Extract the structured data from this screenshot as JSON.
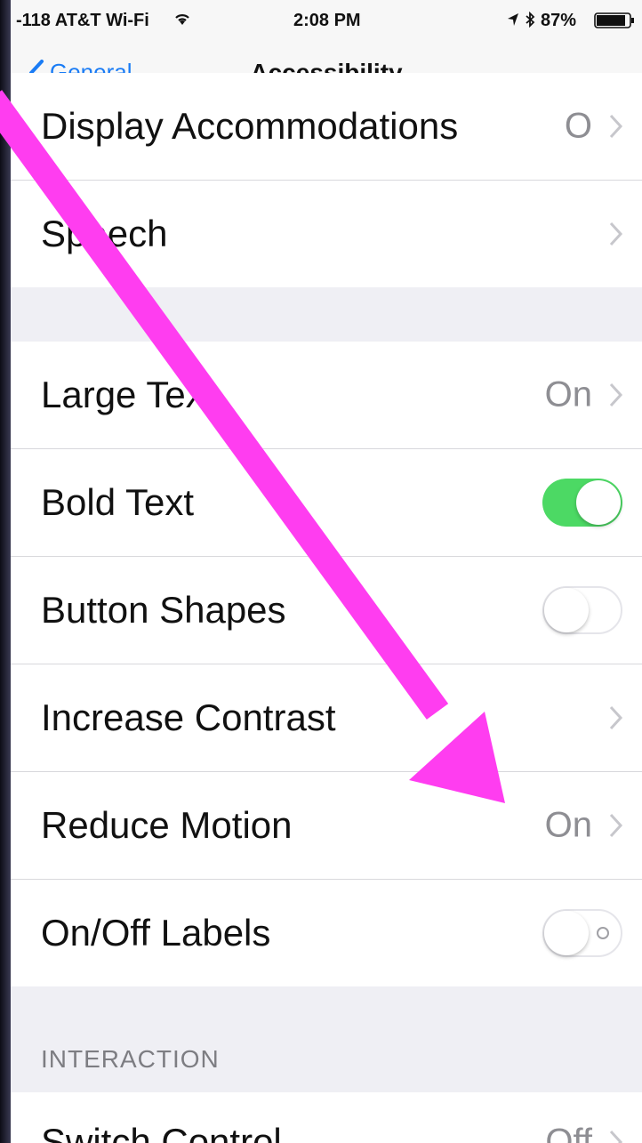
{
  "status_bar": {
    "carrier": "-118 AT&T Wi-Fi",
    "time": "2:08 PM",
    "battery": "87%"
  },
  "nav": {
    "back_label": "General",
    "title": "Accessibility"
  },
  "group_top": [
    {
      "label": "Display Accommodations",
      "value": "O"
    },
    {
      "label": "Speech",
      "value": ""
    }
  ],
  "group_vision": [
    {
      "label": "Large Text",
      "value": "On"
    },
    {
      "label": "Bold Text",
      "toggle": "on"
    },
    {
      "label": "Button Shapes",
      "toggle": "off"
    },
    {
      "label": "Increase Contrast",
      "value": ""
    },
    {
      "label": "Reduce Motion",
      "value": "On"
    },
    {
      "label": "On/Off Labels",
      "toggle": "off"
    }
  ],
  "interaction_header": "INTERACTION",
  "group_interaction": [
    {
      "label": "Switch Control",
      "value": "Off"
    }
  ],
  "colors": {
    "tint": "#1a7cf5",
    "toggle_on": "#4cd964",
    "annotation_arrow": "#ff3df0"
  }
}
